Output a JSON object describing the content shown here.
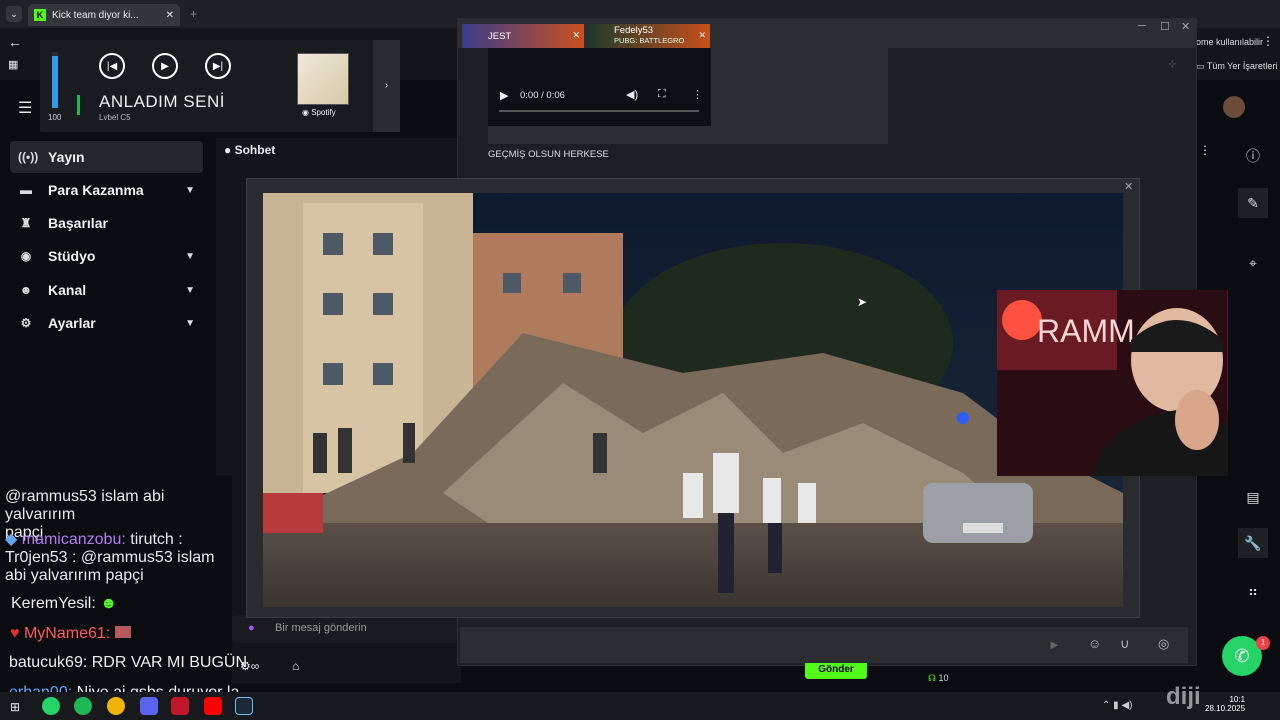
{
  "browser": {
    "tab_title": "Kick team diyor ki...",
    "bookmark_note": "ome kullanılabilir",
    "bookmarks_folder": "Tüm Yer İşaretleri"
  },
  "spotify": {
    "volume": "100",
    "song": "ANLADIM SENİ",
    "artist": "Lvbel C5",
    "brand": "Spotify"
  },
  "nav": {
    "items": [
      {
        "label": "Yayın",
        "icon": "broadcast-icon"
      },
      {
        "label": "Para Kazanma",
        "icon": "money-icon"
      },
      {
        "label": "Başarılar",
        "icon": "trophy-icon"
      },
      {
        "label": "Stüdyo",
        "icon": "studio-icon"
      },
      {
        "label": "Kanal",
        "icon": "channel-icon"
      },
      {
        "label": "Ayarlar",
        "icon": "settings-icon"
      }
    ]
  },
  "chat": {
    "header": "Sohbet",
    "placeholder": "Bir mesaj gönderin",
    "messages": [
      {
        "user": "@rammus53 islam abi yalvarırım",
        "text": "papçi"
      },
      {
        "user": "mamicanzobu:",
        "text": "tirutch : Tr0jen53 : @rammus53 islam abi yalvarırım papçi"
      },
      {
        "user": "KeremYesil:",
        "text": ""
      },
      {
        "user": "MyName61:",
        "text": ""
      },
      {
        "user": "batucuk69:",
        "text": "RDR VAR MI BUGÜN"
      },
      {
        "user": "erhan00:",
        "text": "Niye ai gsbs duruyor la"
      }
    ],
    "send_label": "Gönder",
    "viewer_count": "10"
  },
  "discord": {
    "tabs": [
      {
        "label": "JEST"
      },
      {
        "label": "Fedely53",
        "sub": "PUBG: BATTLEGRO"
      }
    ],
    "video_time": "0:00 / 0:06",
    "message": "GEÇMİŞ OLSUN HERKESE",
    "notif_count": "1"
  },
  "taskbar": {
    "time": "10:1",
    "date": "28.10.2025",
    "watermark": "diji"
  },
  "colors": {
    "kick_green": "#53fc18",
    "accent_blue": "#2c9bf0",
    "spotify_green": "#1db954",
    "whatsapp_green": "#25d366"
  }
}
